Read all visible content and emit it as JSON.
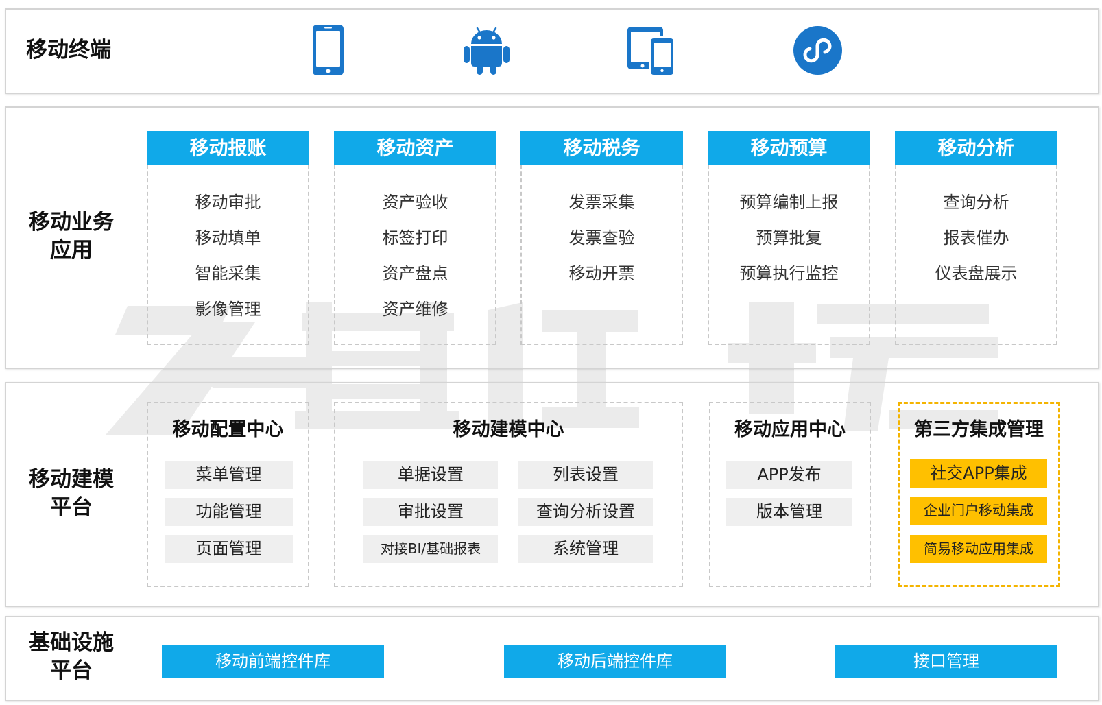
{
  "rows": {
    "terminal": {
      "label": "移动终端",
      "icons": [
        "smartphone-icon",
        "android-icon",
        "tablet-phone-icon",
        "mini-program-icon"
      ]
    },
    "business": {
      "label": [
        "移动业务",
        "应用"
      ],
      "modules": [
        {
          "title": "移动报账",
          "items": [
            "移动审批",
            "移动填单",
            "智能采集",
            "影像管理"
          ]
        },
        {
          "title": "移动资产",
          "items": [
            "资产验收",
            "标签打印",
            "资产盘点",
            "资产维修"
          ]
        },
        {
          "title": "移动税务",
          "items": [
            "发票采集",
            "发票查验",
            "移动开票"
          ]
        },
        {
          "title": "移动预算",
          "items": [
            "预算编制上报",
            "预算批复",
            "预算执行监控"
          ]
        },
        {
          "title": "移动分析",
          "items": [
            "查询分析",
            "报表催办",
            "仪表盘展示"
          ]
        }
      ]
    },
    "modeling": {
      "label": [
        "移动建模",
        "平台"
      ],
      "config_center": {
        "title": "移动配置中心",
        "items": [
          "菜单管理",
          "功能管理",
          "页面管理"
        ]
      },
      "modeling_center": {
        "title": "移动建模中心",
        "items": [
          "单据设置",
          "列表设置",
          "审批设置",
          "查询分析设置",
          "对接BI/基础报表",
          "系统管理"
        ]
      },
      "app_center": {
        "title": "移动应用中心",
        "items": [
          "APP发布",
          "版本管理"
        ]
      },
      "third_party": {
        "title": "第三方集成管理",
        "items": [
          "社交APP集成",
          "企业门户移动集成",
          "简易移动应用集成"
        ]
      }
    },
    "infrastructure": {
      "label": [
        "基础设施",
        "平台"
      ],
      "components": [
        "移动前端控件库",
        "移动后端控件库",
        "接口管理"
      ]
    }
  },
  "colors": {
    "accent_blue": "#10a9e9",
    "icon_blue": "#1a76c9",
    "tile_gray": "#efefef",
    "highlight_yellow": "#ffc000",
    "highlight_border": "#f4b400",
    "frame_gray": "#d4d4d4",
    "dashed_gray": "#c8c8c8",
    "watermark_gray": "#ebebeb"
  }
}
